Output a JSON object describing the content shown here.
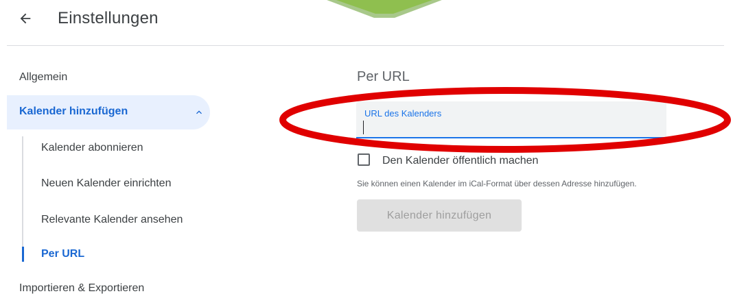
{
  "header": {
    "title": "Einstellungen"
  },
  "sidebar": {
    "items": [
      {
        "label": "Allgemein"
      },
      {
        "label": "Kalender hinzufügen"
      },
      {
        "label": "Importieren & Exportieren"
      }
    ],
    "sub_items": [
      {
        "label": "Kalender abonnieren"
      },
      {
        "label": "Neuen Kalender einrichten"
      },
      {
        "label": "Relevante Kalender ansehen"
      },
      {
        "label": "Per URL"
      }
    ]
  },
  "main": {
    "section_title": "Per URL",
    "url_field": {
      "label": "URL des Kalenders",
      "value": ""
    },
    "public_checkbox": {
      "label": "Den Kalender öffentlich machen",
      "checked": false
    },
    "help_text": "Sie können einen Kalender im iCal-Format über dessen Adresse hinzufügen.",
    "add_button_label": "Kalender hinzufügen"
  },
  "colors": {
    "accent": "#1a73e8",
    "active_bg": "#e8f0fe",
    "annotation": "#e00000",
    "banner_green": "#8fbf4f"
  }
}
